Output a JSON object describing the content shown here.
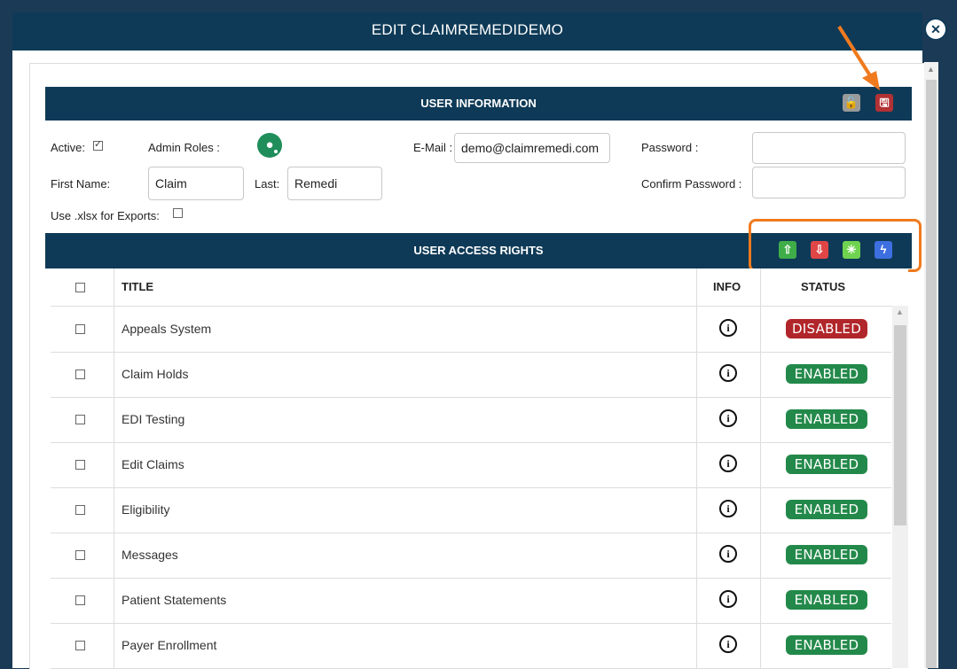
{
  "window": {
    "title": "EDIT CLAIMREMEDIDEMO",
    "close_icon": "✕"
  },
  "user_info": {
    "header": "USER INFORMATION",
    "active_label": "Active:",
    "admin_roles_label": "Admin Roles :",
    "email_label": "E-Mail :",
    "email_value": "demo@claimremedi.com",
    "password_label": "Password :",
    "password_value": "",
    "confirm_password_label": "Confirm Password :",
    "confirm_password_value": "",
    "first_name_label": "First Name:",
    "first_name_value": "Claim",
    "last_label": "Last:",
    "last_value": "Remedi",
    "xlsx_label": "Use .xlsx for Exports:"
  },
  "access_rights": {
    "header": "USER ACCESS RIGHTS",
    "columns": {
      "title": "TITLE",
      "info": "INFO",
      "status": "STATUS"
    },
    "rows": [
      {
        "title": "Appeals System",
        "status": "DISABLED"
      },
      {
        "title": "Claim Holds",
        "status": "ENABLED"
      },
      {
        "title": "EDI Testing",
        "status": "ENABLED"
      },
      {
        "title": "Edit Claims",
        "status": "ENABLED"
      },
      {
        "title": "Eligibility",
        "status": "ENABLED"
      },
      {
        "title": "Messages",
        "status": "ENABLED"
      },
      {
        "title": "Patient Statements",
        "status": "ENABLED"
      },
      {
        "title": "Payer Enrollment",
        "status": "ENABLED"
      }
    ]
  },
  "colors": {
    "header_bg": "#0e3a57",
    "enabled": "#23894a",
    "disabled": "#b1262a",
    "highlight": "#f07a1e"
  },
  "icons": {
    "close": "close-icon",
    "lock": "unlock-icon",
    "save": "save-icon",
    "enable_all": "arrow-up-icon",
    "disable_all": "arrow-down-icon",
    "wand": "magic-wand-icon",
    "bolt": "lightning-icon",
    "info": "info-icon",
    "admin_roles": "user-gear-icon"
  }
}
